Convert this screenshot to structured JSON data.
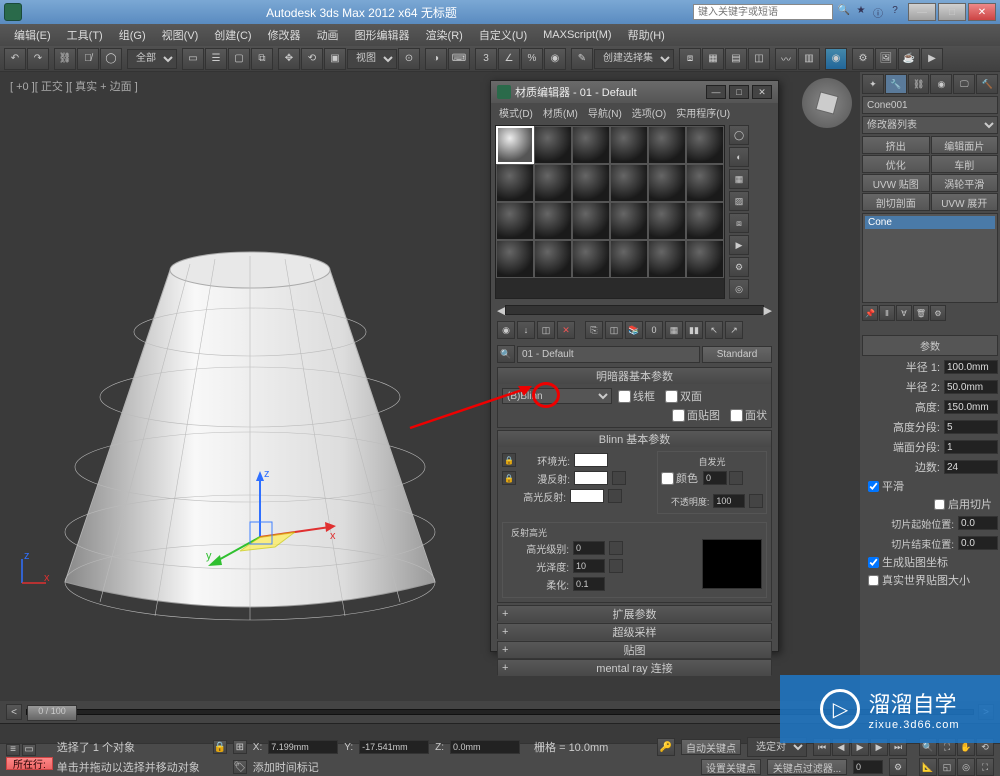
{
  "title": "Autodesk 3ds Max  2012 x64    无标题",
  "searchPlaceholder": "键入关键字或短语",
  "menubar": [
    "编辑(E)",
    "工具(T)",
    "组(G)",
    "视图(V)",
    "创建(C)",
    "修改器",
    "动画",
    "图形编辑器",
    "渲染(R)",
    "自定义(U)",
    "MAXScript(M)",
    "帮助(H)"
  ],
  "toolbar": {
    "dropdown1": "全部",
    "dropdown2": "视图",
    "selset": "创建选择集"
  },
  "viewportLabel": "[ +0 ][ 正交 ][ 真实 + 边面 ]",
  "rightPanel": {
    "objectName": "Cone001",
    "modifierList": "修改器列表",
    "buttons": [
      "挤出",
      "编辑面片",
      "优化",
      "车削",
      "UVW 贴图",
      "涡轮平滑",
      "剖切剖面",
      "UVW 展开"
    ],
    "stackItem": "Cone",
    "paramsHeader": "参数",
    "radius1Label": "半径 1:",
    "radius1": "100.0mm",
    "radius2Label": "半径 2:",
    "radius2": "50.0mm",
    "heightLabel": "高度:",
    "height": "150.0mm",
    "heightSegsLabel": "高度分段:",
    "heightSegs": "5",
    "capSegsLabel": "端面分段:",
    "capSegs": "1",
    "sidesLabel": "边数:",
    "sides": "24",
    "smooth": "平滑",
    "enableSlice": "启用切片",
    "sliceFromLabel": "切片起始位置:",
    "sliceFrom": "0.0",
    "sliceToLabel": "切片结束位置:",
    "sliceTo": "0.0",
    "genMapCoords": "生成贴图坐标",
    "realWorld": "真实世界贴图大小"
  },
  "materialEditor": {
    "title": "材质编辑器 - 01 - Default",
    "menus": [
      "模式(D)",
      "材质(M)",
      "导航(N)",
      "选项(O)",
      "实用程序(U)"
    ],
    "materialName": "01 - Default",
    "materialType": "Standard",
    "shaderRollout": "明暗器基本参数",
    "shaderType": "(B)Blinn",
    "wireframe": "线框",
    "twoSided": "双面",
    "faceMap": "面贴图",
    "faceted": "面状",
    "blinnRollout": "Blinn 基本参数",
    "selfIllum": "自发光",
    "colorCheck": "颜色",
    "ambient": "环境光:",
    "diffuse": "漫反射:",
    "specular": "高光反射:",
    "opacityLabel": "不透明度:",
    "opacity": "100",
    "specHighlights": "反射高光",
    "specLevelLabel": "高光级别:",
    "specLevel": "0",
    "glossLabel": "光泽度:",
    "gloss": "10",
    "softenLabel": "柔化:",
    "soften": "0.1",
    "extended": "扩展参数",
    "supersample": "超级采样",
    "maps": "贴图",
    "mentalray": "mental ray 连接"
  },
  "timeline": {
    "frame": "0 / 100"
  },
  "status": {
    "nowBtn": "所在行:",
    "selected": "选择了 1 个对象",
    "hint": "单击并拖动以选择并移动对象",
    "addTimeTag": "添加时间标记",
    "x": "7.199mm",
    "y": "-17.541mm",
    "z": "0.0mm",
    "grid": "栅格 = 10.0mm",
    "autoKey": "自动关键点",
    "selLock": "选定对象",
    "setKey": "设置关键点",
    "keyFilter": "关键点过滤器..."
  },
  "watermark": {
    "main": "溜溜自学",
    "sub": "zixue.3d66.com"
  }
}
